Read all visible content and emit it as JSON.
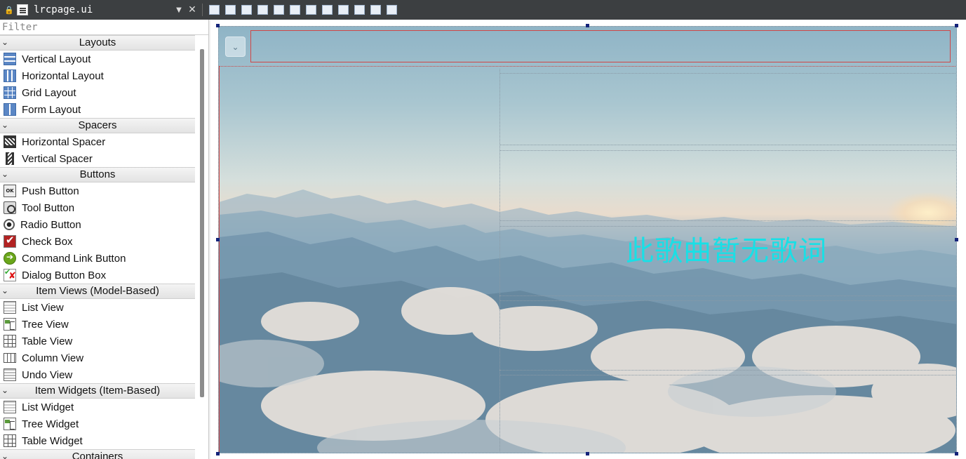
{
  "window": {
    "filename": "lrcpage.ui",
    "toolbar_icons": [
      "edit-widgets-icon",
      "edit-signals-icon",
      "edit-buddies-icon",
      "edit-tab-order-icon",
      "lay-out-horizontally-icon",
      "lay-out-vertically-icon",
      "lay-out-horizontal-splitter-icon",
      "lay-out-vertical-splitter-icon",
      "lay-out-form-icon",
      "lay-out-grid-icon",
      "break-layout-icon",
      "adjust-size-icon"
    ]
  },
  "widget_box": {
    "filter_placeholder": "Filter",
    "categories": [
      {
        "label": "Layouts",
        "items": [
          {
            "label": "Vertical Layout",
            "icon": "vertical-layout-icon"
          },
          {
            "label": "Horizontal Layout",
            "icon": "horizontal-layout-icon"
          },
          {
            "label": "Grid Layout",
            "icon": "grid-layout-icon"
          },
          {
            "label": "Form Layout",
            "icon": "form-layout-icon"
          }
        ]
      },
      {
        "label": "Spacers",
        "items": [
          {
            "label": "Horizontal Spacer",
            "icon": "horizontal-spacer-icon"
          },
          {
            "label": "Vertical Spacer",
            "icon": "vertical-spacer-icon"
          }
        ]
      },
      {
        "label": "Buttons",
        "items": [
          {
            "label": "Push Button",
            "icon": "push-button-icon"
          },
          {
            "label": "Tool Button",
            "icon": "tool-button-icon"
          },
          {
            "label": "Radio Button",
            "icon": "radio-button-icon"
          },
          {
            "label": "Check Box",
            "icon": "check-box-icon"
          },
          {
            "label": "Command Link Button",
            "icon": "command-link-icon"
          },
          {
            "label": "Dialog Button Box",
            "icon": "dialog-button-box-icon"
          }
        ]
      },
      {
        "label": "Item Views (Model-Based)",
        "items": [
          {
            "label": "List View",
            "icon": "list-view-icon"
          },
          {
            "label": "Tree View",
            "icon": "tree-view-icon"
          },
          {
            "label": "Table View",
            "icon": "table-view-icon"
          },
          {
            "label": "Column View",
            "icon": "column-view-icon"
          },
          {
            "label": "Undo View",
            "icon": "undo-view-icon"
          }
        ]
      },
      {
        "label": "Item Widgets (Item-Based)",
        "items": [
          {
            "label": "List Widget",
            "icon": "list-widget-icon"
          },
          {
            "label": "Tree Widget",
            "icon": "tree-widget-icon"
          },
          {
            "label": "Table Widget",
            "icon": "table-widget-icon"
          }
        ]
      },
      {
        "label": "Containers",
        "items": []
      }
    ]
  },
  "form": {
    "lyric_text": "此歌曲暂无歌词",
    "lyric_color": "#18e0e6",
    "frame_color": "#d04646"
  }
}
